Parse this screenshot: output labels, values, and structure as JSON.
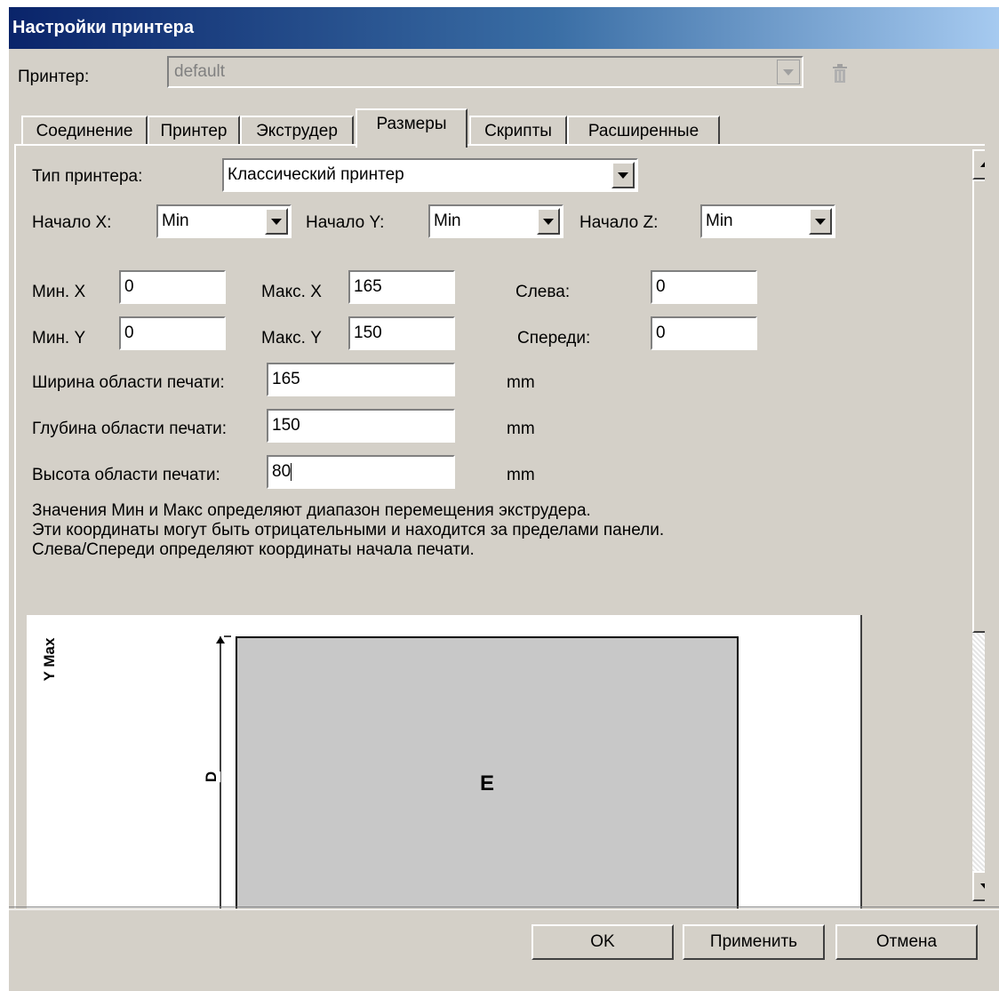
{
  "window": {
    "title": "Настройки принтера"
  },
  "printer": {
    "label": "Принтер:",
    "value": "default"
  },
  "tabs": [
    {
      "label": "Соединение"
    },
    {
      "label": "Принтер"
    },
    {
      "label": "Экструдер"
    },
    {
      "label": "Размеры",
      "active": true
    },
    {
      "label": "Скрипты"
    },
    {
      "label": "Расширенные"
    }
  ],
  "form": {
    "printer_type": {
      "label": "Тип принтера:",
      "value": "Классический принтер"
    },
    "home_x": {
      "label": "Начало X:",
      "value": "Min"
    },
    "home_y": {
      "label": "Начало Y:",
      "value": "Min"
    },
    "home_z": {
      "label": "Начало Z:",
      "value": "Min"
    },
    "min_x": {
      "label": "Мин. X",
      "value": "0"
    },
    "max_x": {
      "label": "Макс. X",
      "value": "165"
    },
    "left": {
      "label": "Слева:",
      "value": "0"
    },
    "min_y": {
      "label": "Мин. Y",
      "value": "0"
    },
    "max_y": {
      "label": "Макс. Y",
      "value": "150"
    },
    "front": {
      "label": "Спереди:",
      "value": "0"
    },
    "width": {
      "label": "Ширина области печати:",
      "value": "165",
      "unit": "mm"
    },
    "depth": {
      "label": "Глубина области печати:",
      "value": "150",
      "unit": "mm"
    },
    "height": {
      "label": "Высота области печати:",
      "value": "80",
      "unit": "mm"
    },
    "help": [
      "Значения Мин и Макс определяют диапазон перемещения экструдера.",
      "Эти координаты могут быть отрицательными и находится за пределами панели.",
      "Слева/Спереди определяют координаты начала печати."
    ]
  },
  "diagram": {
    "y_axis_label": "Y Max",
    "dim_label": "D",
    "area_label": "E"
  },
  "buttons": {
    "ok": "OK",
    "apply": "Применить",
    "cancel": "Отмена"
  },
  "colors": {
    "title_start": "#0a246a",
    "title_end": "#a6caf0",
    "dialog_bg": "#d4d0c8",
    "print_area": "#c8c8c8"
  }
}
